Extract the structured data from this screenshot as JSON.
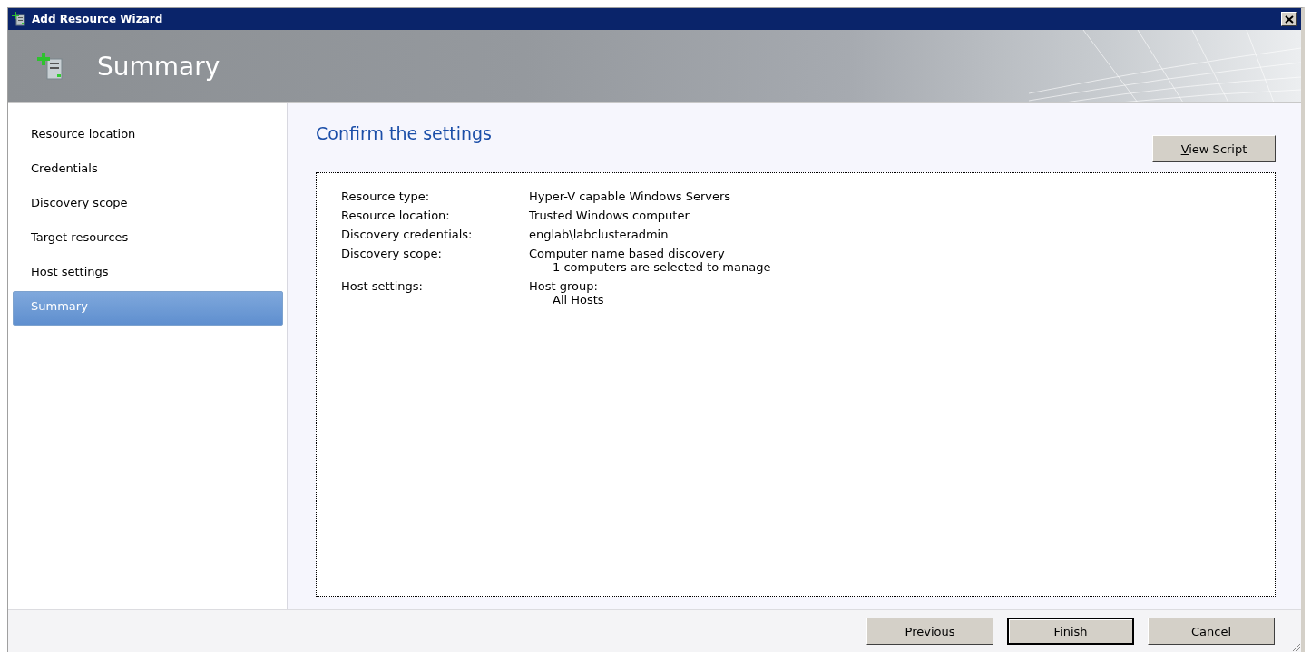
{
  "window": {
    "title": "Add Resource Wizard"
  },
  "header": {
    "title": "Summary"
  },
  "sidebar": {
    "items": [
      {
        "label": "Resource location",
        "selected": false
      },
      {
        "label": "Credentials",
        "selected": false
      },
      {
        "label": "Discovery scope",
        "selected": false
      },
      {
        "label": "Target resources",
        "selected": false
      },
      {
        "label": "Host settings",
        "selected": false
      },
      {
        "label": "Summary",
        "selected": true
      }
    ]
  },
  "content": {
    "heading": "Confirm the settings",
    "view_script_button": {
      "label": "View Script",
      "mnemonic": true
    },
    "summary": [
      {
        "label": "Resource type:",
        "value": "Hyper-V capable Windows Servers"
      },
      {
        "label": "Resource location:",
        "value": "Trusted Windows computer"
      },
      {
        "label": "Discovery credentials:",
        "value": "englab\\labclusteradmin"
      },
      {
        "label": "Discovery scope:",
        "value": "Computer name based discovery",
        "details": [
          "1 computers are selected to manage"
        ]
      },
      {
        "label": "Host settings:",
        "value": "Host group:",
        "details": [
          "All Hosts"
        ]
      }
    ]
  },
  "buttons": [
    {
      "label": "Previous",
      "mnemonic": true,
      "default": false
    },
    {
      "label": "Finish",
      "mnemonic": true,
      "default": true
    },
    {
      "label": "Cancel",
      "mnemonic": false,
      "default": false
    }
  ]
}
